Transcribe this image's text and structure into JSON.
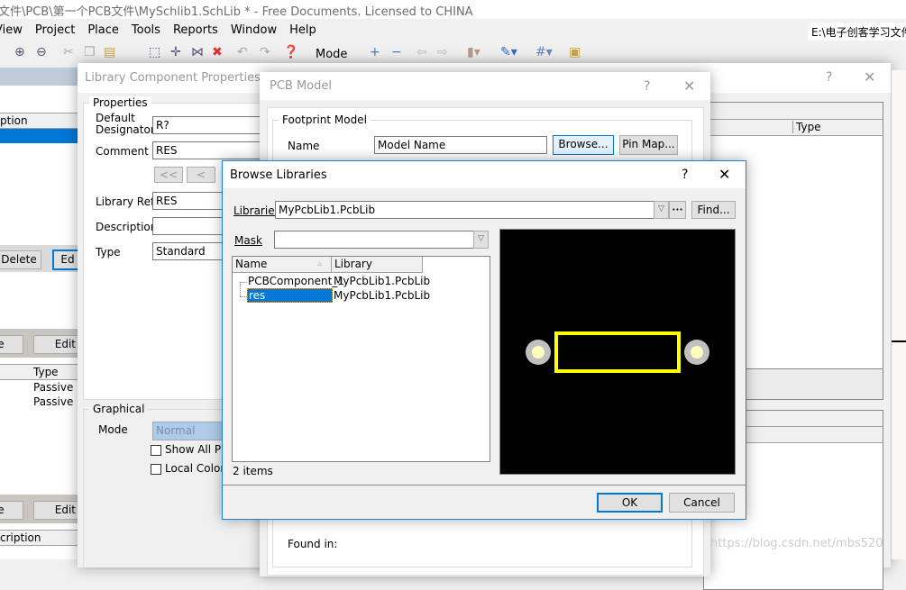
{
  "app": {
    "title": "文件\\PCB\\第一个PCB文件\\MySchlib1.SchLib * - Free Documents. Licensed to CHINA",
    "path_box": "E:\\电子创客学习文件"
  },
  "menu": [
    "View",
    "Project",
    "Place",
    "Tools",
    "Reports",
    "Window",
    "Help"
  ],
  "toolbar": {
    "mode_label": "Mode"
  },
  "left_panel": {
    "col_header": "ption",
    "delete": "Delete",
    "edit_partial": "Ed",
    "btn_partial": "e",
    "edit": "Edit",
    "type_header": "Type",
    "types": [
      "Passive",
      "Passive"
    ],
    "btn_partial2": "e",
    "edit2": "Edit",
    "desc_header": "cription"
  },
  "lcp": {
    "title": "Library Component Properties",
    "help": "?",
    "properties": "Properties",
    "default_designator_label": "Default Designator",
    "default_designator": "R?",
    "comment_label": "Comment",
    "comment": "RES",
    "nav_first": "<<",
    "nav_prev": "<",
    "library_ref_label": "Library Ref",
    "library_ref": "RES",
    "description_label": "Description",
    "description": "",
    "type_label": "Type",
    "type": "Standard",
    "graphical": "Graphical",
    "mode_label": "Mode",
    "mode": "Normal",
    "show_all_pins": "Show All Pins",
    "local_colors": "Local Colors",
    "right_type_header": "Type"
  },
  "pcb_model": {
    "title": "PCB Model",
    "help": "?",
    "footprint_model": "Footprint Model",
    "name_label": "Name",
    "name_value": "Model Name",
    "browse": "Browse...",
    "pin_map": "Pin Map...",
    "found_in": "Found in:"
  },
  "browse": {
    "title": "Browse Libraries",
    "help": "?",
    "libraries_label": "Libraries",
    "libraries_value": "MyPcbLib1.PcbLib",
    "more": "•••",
    "find": "Find...",
    "mask_label": "Mask",
    "mask_value": "",
    "columns": [
      "Name",
      "Library"
    ],
    "rows": [
      {
        "name": "PCBComponent_1",
        "library": "MyPcbLib1.PcbLib",
        "selected": false
      },
      {
        "name": "res",
        "library": "MyPcbLib1.PcbLib",
        "selected": true
      }
    ],
    "count": "2 items",
    "ok": "OK",
    "cancel": "Cancel",
    "preview_colors": {
      "background": "#000000",
      "outline": "#ffff00",
      "pad": "#c0c0c0",
      "hole": "#ffffc0"
    }
  },
  "watermark": "https://blog.csdn.net/mbs520"
}
